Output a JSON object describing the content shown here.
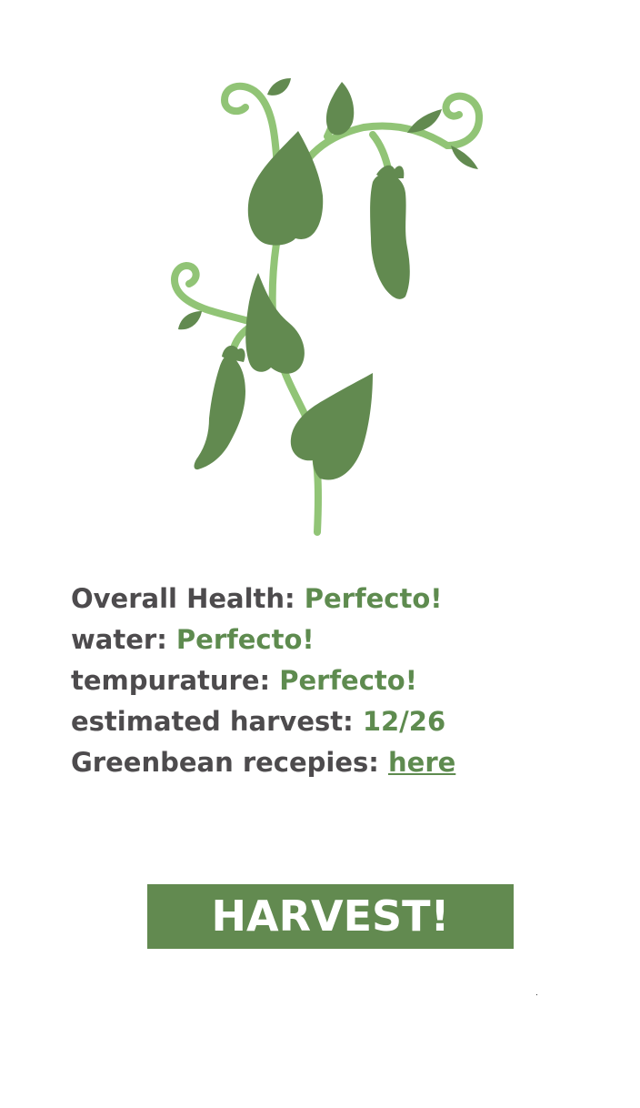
{
  "plant": {
    "icon": "green-bean-plant-illustration",
    "colors": {
      "stem": "#91c476",
      "leaf": "#628a50"
    }
  },
  "stats": {
    "overall_health": {
      "label": "Overall Health:",
      "value": "Perfecto!"
    },
    "water": {
      "label": "water:",
      "value": "Perfecto!"
    },
    "temperature": {
      "label": "tempurature:",
      "value": "Perfecto!"
    },
    "harvest": {
      "label": "estimated harvest:",
      "value": "12/26"
    },
    "recipes": {
      "label": "Greenbean recepies:",
      "link": "here"
    }
  },
  "harvest_button": {
    "label": "HARVEST!"
  },
  "colors": {
    "label_text": "#4d4b4d",
    "value_text": "#5e8b4f",
    "button_bg": "#628a50",
    "button_text": "#ffffff"
  }
}
